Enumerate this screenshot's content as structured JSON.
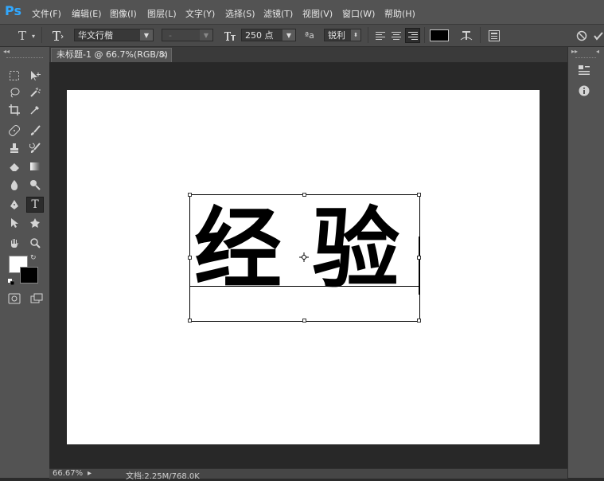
{
  "app": {
    "logo": "Ps"
  },
  "menu": [
    "文件(F)",
    "编辑(E)",
    "图像(I)",
    "图层(L)",
    "文字(Y)",
    "选择(S)",
    "滤镜(T)",
    "视图(V)",
    "窗口(W)",
    "帮助(H)"
  ],
  "options": {
    "font_family": "华文行楷",
    "font_style": "-",
    "font_size": "250 点",
    "antialias_icon": "ªa",
    "antialias": "锐利",
    "text_color": "#000000"
  },
  "document_tab": {
    "title": "未标题-1 @ 66.7%(RGB/8)",
    "close": "×"
  },
  "canvas_text": "经 验",
  "status": {
    "zoom": "66.67%",
    "doc_info": "文档:2.25M/768.0K"
  },
  "panel_collapse": {
    "left": "◂◂",
    "right_a": "▸▸",
    "right_b": "◂"
  }
}
